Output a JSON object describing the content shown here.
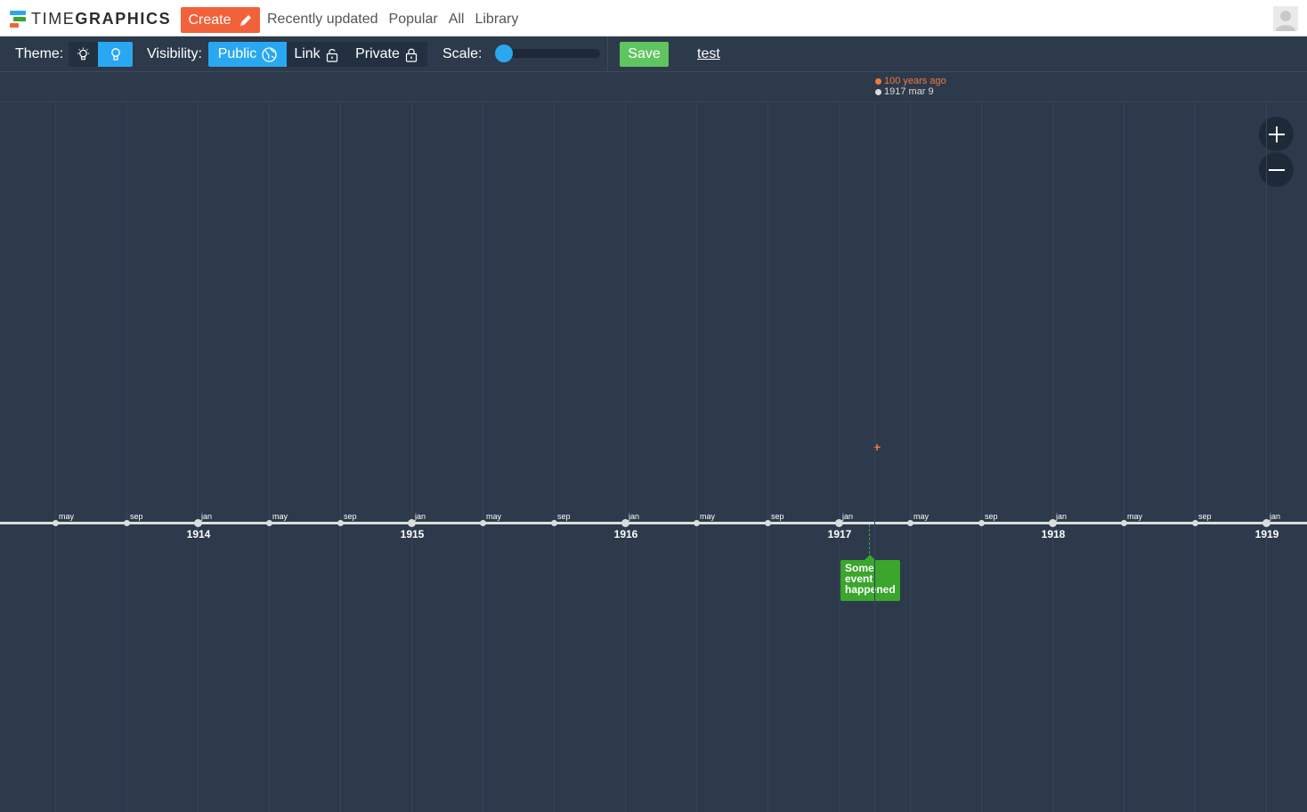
{
  "brand": {
    "name_light": "TIME",
    "name_bold": "GRAPHICS",
    "logo_colors": [
      "#29a8f1",
      "#3aa62b",
      "#f1623b"
    ]
  },
  "topnav": {
    "create_label": "Create",
    "create_color": "#f1623b",
    "links": [
      "Recently updated",
      "Popular",
      "All",
      "Library"
    ]
  },
  "toolbar": {
    "theme_label": "Theme:",
    "visibility_label": "Visibility:",
    "visibility_options": [
      {
        "label": "Public",
        "active": true
      },
      {
        "label": "Link",
        "active": false
      },
      {
        "label": "Private",
        "active": false
      }
    ],
    "scale_label": "Scale:",
    "scale_level": 0.0,
    "save_label": "Save",
    "save_color": "#5fc55f",
    "title": "test"
  },
  "timeline": {
    "now_ago": "100 years ago",
    "now_ago_color": "#f07a3a",
    "now_date": "1917 mar 9",
    "now_date_color": "#dcdcdc",
    "start_year": 1914,
    "end_year": 1919,
    "month_ticks": [
      "may",
      "sep",
      "jan"
    ],
    "years": [
      "1914",
      "1915",
      "1916",
      "1917",
      "1918",
      "1919"
    ],
    "event": {
      "text": "Some event happened",
      "date": "1917 mar 9",
      "color": "#3aa62b"
    },
    "accent": "#29a8f1",
    "cursor_color": "#f07a3a"
  }
}
